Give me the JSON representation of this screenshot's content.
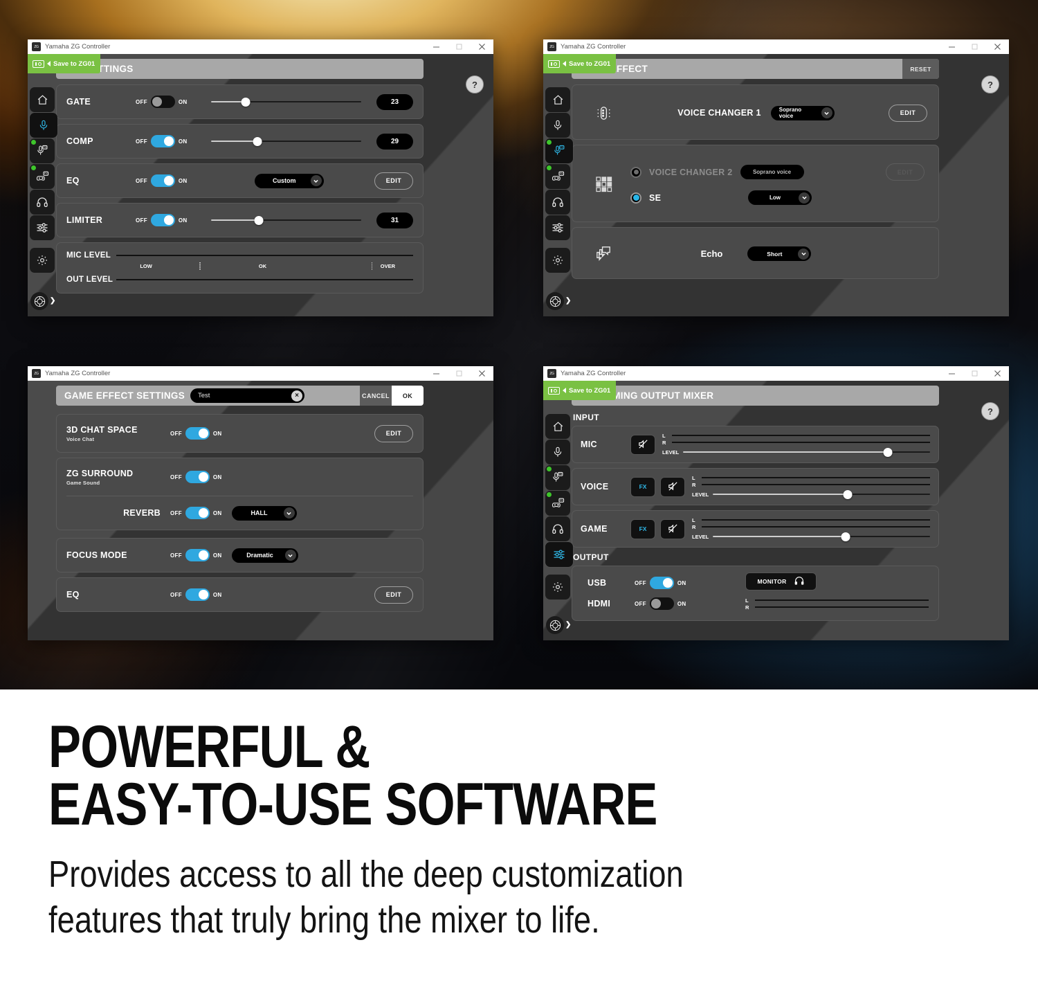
{
  "window_title": "Yamaha ZG Controller",
  "window_controls": {
    "minimize": "–",
    "maximize": "□",
    "close": "×"
  },
  "save_button_label": "Save to ZG01",
  "help_label": "?",
  "sidebar": {
    "items": [
      {
        "name": "home",
        "icon": "home-icon",
        "active": false,
        "badge": false
      },
      {
        "name": "mic-settings",
        "icon": "microphone-icon",
        "active": false,
        "badge": false
      },
      {
        "name": "mic-effect",
        "icon": "microphone-fx-icon",
        "active": false,
        "badge": true
      },
      {
        "name": "game-effect",
        "icon": "gamepad-fx-icon",
        "active": false,
        "badge": true
      },
      {
        "name": "headphone",
        "icon": "headphone-icon",
        "active": false,
        "badge": false
      },
      {
        "name": "mixer",
        "icon": "sliders-icon",
        "active": false,
        "badge": false
      },
      {
        "name": "settings",
        "icon": "gear-icon",
        "active": false,
        "badge": false
      }
    ],
    "device_button": {
      "icon": "device-dial-icon",
      "chevron": "❯"
    }
  },
  "panels": {
    "mic_settings": {
      "title": "MIC SETTINGS",
      "rows": [
        {
          "label": "GATE",
          "off": "OFF",
          "on": "ON",
          "toggle": "off",
          "slider": 23,
          "value": "23"
        },
        {
          "label": "COMP",
          "off": "OFF",
          "on": "ON",
          "toggle": "on",
          "slider": 29,
          "value": "29"
        },
        {
          "label": "EQ",
          "off": "OFF",
          "on": "ON",
          "toggle": "on",
          "dropdown": "Custom",
          "edit": "EDIT"
        },
        {
          "label": "LIMITER",
          "off": "OFF",
          "on": "ON",
          "toggle": "on",
          "slider": 31,
          "value": "31"
        }
      ],
      "meters": {
        "mic_level_label": "MIC LEVEL",
        "out_level_label": "OUT LEVEL",
        "marks": [
          "LOW",
          "OK",
          "OVER"
        ]
      }
    },
    "mic_effect": {
      "title": "MIC EFFECT",
      "reset_label": "RESET",
      "voice_changer_1": {
        "label": "VOICE CHANGER 1",
        "preset": "Soprano voice",
        "edit": "EDIT",
        "icon": "voice-changer-icon"
      },
      "voice_changer_2": {
        "label": "VOICE CHANGER 2",
        "preset": "Soprano voice",
        "edit": "EDIT",
        "selected": false
      },
      "se": {
        "label": "SE",
        "preset": "Low",
        "selected": true,
        "icon": "se-grid-icon"
      },
      "echo": {
        "label": "Echo",
        "preset": "Short",
        "icon": "echo-icon"
      }
    },
    "game_effect": {
      "title": "GAME EFFECT SETTINGS",
      "name_value": "Test",
      "name_placeholder": "Test",
      "clear_icon": "×",
      "cancel_label": "CANCEL",
      "ok_label": "OK",
      "rows": [
        {
          "label": "3D CHAT SPACE",
          "sub": "Voice Chat",
          "off": "OFF",
          "on": "ON",
          "toggle": "on",
          "edit": "EDIT"
        },
        {
          "label": "ZG SURROUND",
          "sub": "Game Sound",
          "off": "OFF",
          "on": "ON",
          "toggle": "on"
        },
        {
          "label": "REVERB",
          "off": "OFF",
          "on": "ON",
          "toggle": "on",
          "dropdown": "HALL"
        },
        {
          "label": "FOCUS MODE",
          "off": "OFF",
          "on": "ON",
          "toggle": "on",
          "dropdown": "Dramatic"
        },
        {
          "label": "EQ",
          "off": "OFF",
          "on": "ON",
          "toggle": "on",
          "edit": "EDIT"
        }
      ]
    },
    "streaming_mixer": {
      "title": "STREAMING OUTPUT MIXER",
      "input_label": "INPUT",
      "output_label": "OUTPUT",
      "level_label": "LEVEL",
      "l_label": "L",
      "r_label": "R",
      "fx_label": "FX",
      "mute_icon": "mute-icon",
      "inputs": [
        {
          "name": "MIC",
          "has_fx": false,
          "level": 83
        },
        {
          "name": "VOICE",
          "has_fx": true,
          "level": 62
        },
        {
          "name": "GAME",
          "has_fx": true,
          "level": 61
        }
      ],
      "outputs": [
        {
          "name": "USB",
          "off": "OFF",
          "on": "ON",
          "toggle": "on"
        },
        {
          "name": "HDMI",
          "off": "OFF",
          "on": "ON",
          "toggle": "off"
        }
      ],
      "monitor_label": "MONITOR",
      "monitor_icon": "headphone-icon"
    }
  },
  "marketing": {
    "headline_line1": "POWERFUL &",
    "headline_line2": "EASY-TO-USE SOFTWARE",
    "subhead_line1": "Provides access to all the deep customization",
    "subhead_line2": "features that truly bring the mixer to life."
  },
  "colors": {
    "accent_blue": "#2fa8e0",
    "save_green": "#7ac143",
    "status_green": "#3ec62b",
    "panel_gray": "#4a4a4a",
    "header_gray": "#a8a8a8"
  }
}
